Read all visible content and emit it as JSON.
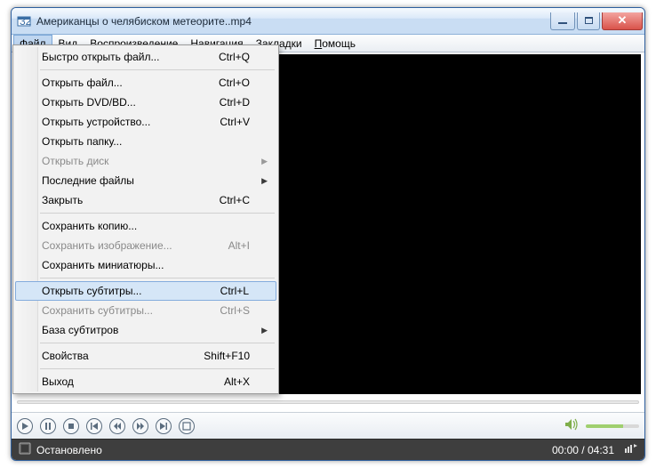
{
  "window": {
    "title": "Американцы о челябиском метеорите..mp4"
  },
  "menubar": [
    {
      "label": "Файл",
      "accel": "Ф",
      "active": true
    },
    {
      "label": "Вид",
      "accel": "В"
    },
    {
      "label": "Воспроизведение",
      "accel": "о"
    },
    {
      "label": "Навигация",
      "accel": "Н"
    },
    {
      "label": "Закладки",
      "accel": "З"
    },
    {
      "label": "Помощь",
      "accel": "П"
    }
  ],
  "file_menu": [
    {
      "label": "Быстро открыть файл...",
      "shortcut": "Ctrl+Q"
    },
    {
      "sep": true
    },
    {
      "label": "Открыть файл...",
      "shortcut": "Ctrl+O"
    },
    {
      "label": "Открыть DVD/BD...",
      "shortcut": "Ctrl+D"
    },
    {
      "label": "Открыть устройство...",
      "shortcut": "Ctrl+V"
    },
    {
      "label": "Открыть папку..."
    },
    {
      "label": "Открыть диск",
      "submenu": true,
      "disabled": true
    },
    {
      "label": "Последние файлы",
      "submenu": true
    },
    {
      "label": "Закрыть",
      "shortcut": "Ctrl+C"
    },
    {
      "sep": true
    },
    {
      "label": "Сохранить копию..."
    },
    {
      "label": "Сохранить изображение...",
      "shortcut": "Alt+I",
      "disabled": true
    },
    {
      "label": "Сохранить миниатюры..."
    },
    {
      "sep": true
    },
    {
      "label": "Открыть субтитры...",
      "shortcut": "Ctrl+L",
      "hover": true
    },
    {
      "label": "Сохранить субтитры...",
      "shortcut": "Ctrl+S",
      "disabled": true
    },
    {
      "label": "База субтитров",
      "submenu": true
    },
    {
      "sep": true
    },
    {
      "label": "Свойства",
      "shortcut": "Shift+F10"
    },
    {
      "sep": true
    },
    {
      "label": "Выход",
      "shortcut": "Alt+X"
    }
  ],
  "status": {
    "text": "Остановлено",
    "time": "00:00 / 04:31"
  },
  "controls": {
    "buttons": [
      "play",
      "pause",
      "stop",
      "prev",
      "step-back",
      "step-fwd",
      "next",
      "fullscreen"
    ]
  }
}
